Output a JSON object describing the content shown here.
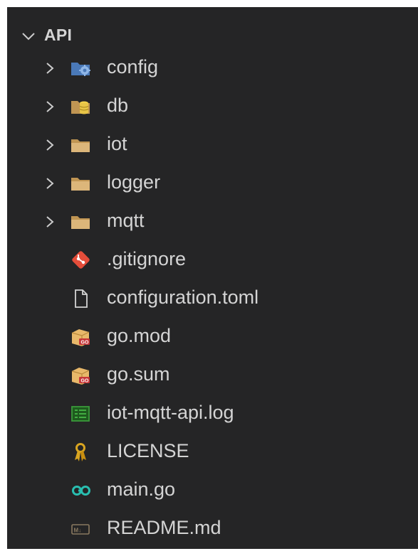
{
  "explorer": {
    "section_title": "API",
    "items": [
      {
        "label": "config",
        "type": "folder",
        "icon": "config-folder-icon",
        "expanded": false
      },
      {
        "label": "db",
        "type": "folder",
        "icon": "db-folder-icon",
        "expanded": false
      },
      {
        "label": "iot",
        "type": "folder",
        "icon": "folder-icon",
        "expanded": false
      },
      {
        "label": "logger",
        "type": "folder",
        "icon": "folder-icon",
        "expanded": false
      },
      {
        "label": "mqtt",
        "type": "folder",
        "icon": "folder-icon",
        "expanded": false
      },
      {
        "label": ".gitignore",
        "type": "file",
        "icon": "git-icon"
      },
      {
        "label": "configuration.toml",
        "type": "file",
        "icon": "file-icon"
      },
      {
        "label": "go.mod",
        "type": "file",
        "icon": "go-package-icon"
      },
      {
        "label": "go.sum",
        "type": "file",
        "icon": "go-package-icon"
      },
      {
        "label": "iot-mqtt-api.log",
        "type": "file",
        "icon": "log-icon"
      },
      {
        "label": "LICENSE",
        "type": "file",
        "icon": "license-icon"
      },
      {
        "label": "main.go",
        "type": "file",
        "icon": "go-icon"
      },
      {
        "label": "README.md",
        "type": "file",
        "icon": "markdown-icon"
      }
    ]
  },
  "colors": {
    "background": "#252526",
    "text": "#d4d4d4",
    "folder": "#c09553",
    "config_folder": "#5b8fd1",
    "db_folder": "#e8c547",
    "git": "#e44d3a",
    "go": "#29beb0",
    "log": "#3a9a3a",
    "license": "#d9a520"
  }
}
